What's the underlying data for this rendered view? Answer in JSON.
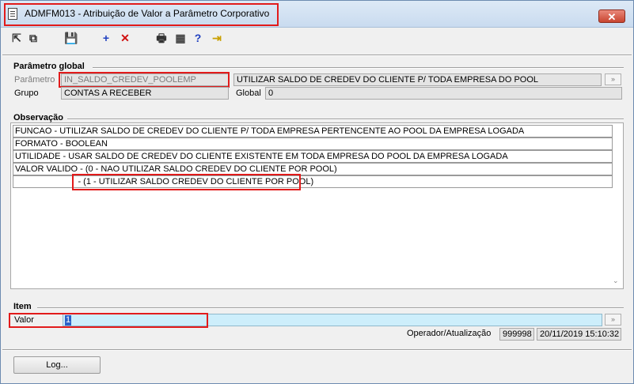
{
  "window": {
    "title": "ADMFM013 - Atribuição de Valor a Parâmetro Corporativo",
    "close_label": "✕"
  },
  "toolbar": {
    "items": [
      {
        "name": "first-record",
        "glyph": "⇱",
        "color": "#333333"
      },
      {
        "name": "copy-records",
        "glyph": "⧉",
        "color": "#333333"
      },
      {
        "name": "save",
        "glyph": "💾",
        "color": "#222222"
      },
      {
        "name": "add",
        "glyph": "+",
        "color": "#1f3fbf"
      },
      {
        "name": "delete",
        "glyph": "✕",
        "color": "#d01010"
      },
      {
        "name": "print",
        "glyph": "🖶",
        "color": "#333333"
      },
      {
        "name": "calculator",
        "glyph": "▦",
        "color": "#444444"
      },
      {
        "name": "help",
        "glyph": "?",
        "color": "#1f3fbf"
      },
      {
        "name": "exit",
        "glyph": "⇥",
        "color": "#c9a000"
      }
    ]
  },
  "parametro_global": {
    "section_title": "Parâmetro global",
    "parametro_label": "Parâmetro",
    "parametro_value": "IN_SALDO_CREDEV_POOLEMP",
    "parametro_description": "UTILIZAR SALDO DE CREDEV DO CLIENTE P/ TODA EMPRESA DO POOL",
    "grupo_label": "Grupo",
    "grupo_value": "CONTAS A RECEBER",
    "global_label": "Global",
    "global_value": "0",
    "lookup_glyph": "»"
  },
  "observacao": {
    "section_title": "Observação",
    "lines": [
      "FUNCAO - UTILIZAR SALDO DE CREDEV DO CLIENTE P/ TODA EMPRESA PERTENCENTE AO POOL DA EMPRESA LOGADA",
      "FORMATO - BOOLEAN",
      "UTILIDADE - USAR SALDO DE CREDEV DO CLIENTE EXISTENTE EM TODA EMPRESA DO POOL DA EMPRESA LOGADA",
      "VALOR VALIDO - (0 - NAO UTILIZAR SALDO CREDEV DO CLIENTE POR POOL)",
      "                          - (1 - UTILIZAR SALDO CREDEV DO CLIENTE POR POOL)"
    ],
    "scroll_glyph": "⌄"
  },
  "item": {
    "section_title": "Item",
    "valor_label": "Valor",
    "valor_value": "1",
    "lookup_glyph": "»",
    "operador_label": "Operador/Atualização",
    "operador_value": "999998",
    "atualizacao_value": "20/11/2019 15:10:32"
  },
  "log_button": "Log...",
  "colors": {
    "highlight": "#e21b1b",
    "value_field": "#cdeefb"
  }
}
